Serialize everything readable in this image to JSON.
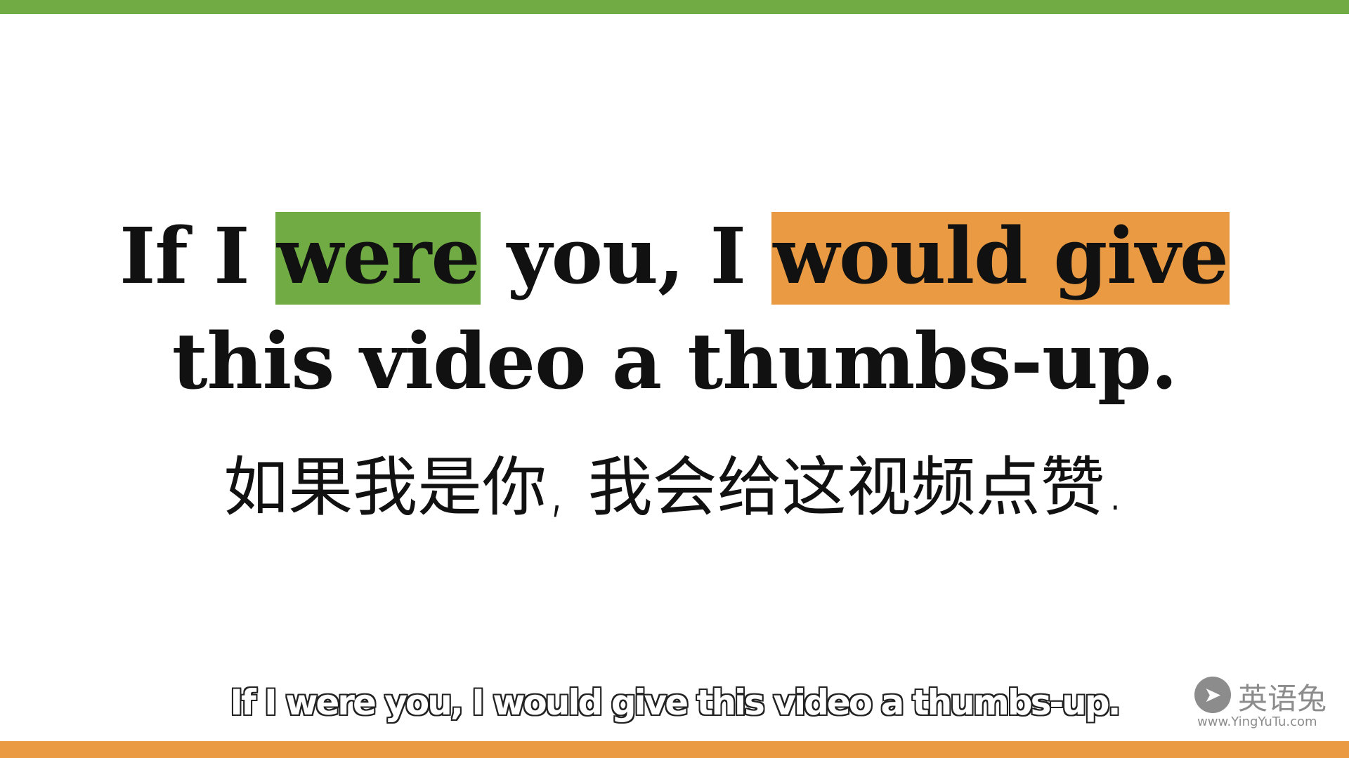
{
  "colors": {
    "top_bar": "#70ab43",
    "bottom_bar": "#e99a42",
    "highlight_green": "#70ab43",
    "highlight_orange": "#e99a42"
  },
  "sentence": {
    "part1": "If I ",
    "highlight1": "were",
    "part2": " you, I ",
    "highlight2": "would give",
    "part3": " this video a thumbs-up."
  },
  "translation": "如果我是你, 我会给这视频点赞.",
  "subtitle": "If I were you, I would give this video a thumbs-up.",
  "logo": {
    "icon": "rabbit-icon",
    "name": "英语兔",
    "url": "www.YingYuTu.com"
  }
}
